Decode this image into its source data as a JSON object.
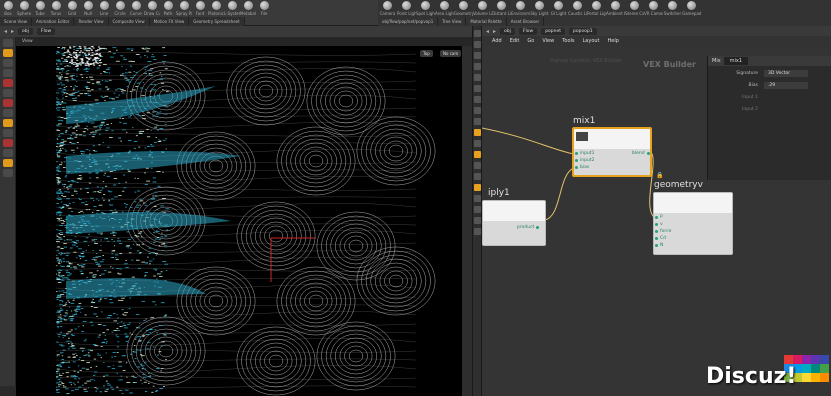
{
  "shelf": {
    "left_tools": [
      "Box",
      "Sphere",
      "Tube",
      "Torus",
      "Grid",
      "Null",
      "Line",
      "Circle",
      "Curve",
      "Draw Curve",
      "Path",
      "Spray Paint",
      "Font",
      "Platonic Solids",
      "L-System",
      "Metaball",
      "File"
    ],
    "right_tools": [
      "Camera",
      "Point Light",
      "Spot Light",
      "Area Light",
      "Geometry Light",
      "Volume Light",
      "Distant Light",
      "Environment Light",
      "Sky Light",
      "GI Light",
      "Caustic Light",
      "Portal Light",
      "Ambient Light",
      "Stereo Camera",
      "VR Camera",
      "Switcher",
      "Gamepad Camera"
    ],
    "left_tabs": [
      "Scene View",
      "Animation Editor",
      "Render View",
      "Composite View",
      "Motion FX View",
      "Geometry Spreadsheet"
    ],
    "right_tabs": [
      "obj/flow/pop/net/popvop1",
      "Tree View",
      "Material Palette",
      "Asset Browser"
    ]
  },
  "viewport": {
    "path": "obj",
    "node": "Flow",
    "title": "View",
    "persp_btn": "Top",
    "cam_btn": "No cam"
  },
  "network": {
    "path_root": "obj",
    "path_items": [
      "Flow",
      "popnet",
      "popvop1"
    ],
    "menu": [
      "Add",
      "Edit",
      "Go",
      "View",
      "Tools",
      "Layout",
      "Help"
    ],
    "context_label": "VEX Builder",
    "context_ghost": "Popvop Context: VEX Builder",
    "nodes": {
      "mix": {
        "name": "mix1",
        "inputs": [
          "input1",
          "input2",
          "bias"
        ],
        "outputs": [
          "blend"
        ]
      },
      "multiply": {
        "name": "iply1",
        "outputs": [
          "product"
        ]
      },
      "geometry": {
        "name": "geometryv",
        "inputs": [
          "P",
          "v",
          "force",
          "Cd",
          "N"
        ]
      }
    }
  },
  "params": {
    "node_type": "Mix",
    "node_name": "mix1",
    "rows": [
      {
        "key": "Signature",
        "value": "3D Vector"
      },
      {
        "key": "Bias",
        "value": ".29"
      },
      {
        "key": "Input 1",
        "value": ""
      },
      {
        "key": "Input 2",
        "value": ""
      }
    ]
  },
  "watermark": {
    "text": "Discuz!",
    "colors": [
      "#e53935",
      "#d81b60",
      "#8e24aa",
      "#5e35b1",
      "#3949ab",
      "#1e88e5",
      "#039be5",
      "#00acc1",
      "#00897b",
      "#43a047",
      "#7cb342",
      "#c0ca33",
      "#fdd835",
      "#ffb300",
      "#fb8c00"
    ]
  },
  "colors": {
    "accent": "#e6a21c",
    "particle": "#2ca7c8",
    "wire": "#e2c36b"
  }
}
